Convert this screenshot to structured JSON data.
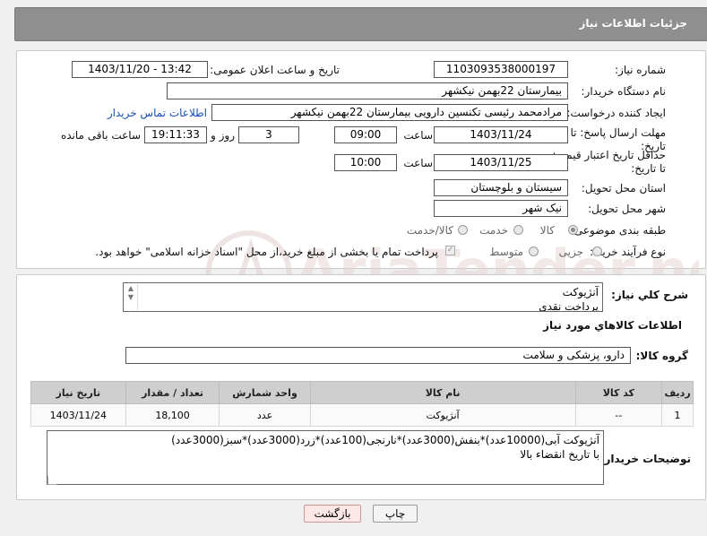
{
  "header": {
    "title": "جزئیات اطلاعات نیاز"
  },
  "form": {
    "need_number_label": "شماره نیاز:",
    "need_number": "1103093538000197",
    "announce_label": "تاریخ و ساعت اعلان عمومی:",
    "announce_value": "1403/11/20 - 13:42",
    "buyer_org_label": "نام دستگاه خریدار:",
    "buyer_org": "بیمارستان 22بهمن نیکشهر",
    "creator_label": "ایجاد کننده درخواست:",
    "creator": "مرادمحمد رئیسی تکنسین دارویی بیمارستان 22بهمن نیکشهر",
    "contact_link": "اطلاعات تماس خریدار",
    "reply_deadline_label": "مهلت ارسال پاسخ: تا تاریخ:",
    "reply_date": "1403/11/24",
    "time_label": "ساعت",
    "reply_time": "09:00",
    "days_value": "3",
    "days_label": "روز و",
    "remaining_time": "19:11:33",
    "remaining_label": "ساعت باقی مانده",
    "price_validity_label": "حداقل تاریخ اعتبار قیمت: تا تاریخ:",
    "price_date": "1403/11/25",
    "price_time": "10:00",
    "province_label": "استان محل تحویل:",
    "province": "سیستان و بلوچستان",
    "city_label": "شهر محل تحویل:",
    "city": "نیک شهر",
    "category_label": "طبقه بندی موضوعی:",
    "category_options": [
      "کالا",
      "خدمت",
      "کالا/خدمت"
    ],
    "process_label": "نوع فرآیند خرید :",
    "process_options": [
      "جزیی",
      "متوسط"
    ],
    "payment_note": "پرداخت تمام یا بخشی از مبلغ خرید،از محل \"اسناد خزانه اسلامی\" خواهد بود."
  },
  "summary": {
    "label": "شرح کلي نياز:",
    "text": "آنژیوکت\nپرداخت نقدی",
    "goods_info_title": "اطلاعات کالاهاي مورد نياز",
    "goods_group_label": "گروه کالا:",
    "goods_group": "دارو، پزشکی و سلامت"
  },
  "table": {
    "headers": [
      "رديف",
      "کد کالا",
      "نام کالا",
      "واحد شمارش",
      "تعداد / مقدار",
      "تاریخ نیاز"
    ],
    "rows": [
      [
        "1",
        "--",
        "آنژیوکت",
        "عدد",
        "18,100",
        "1403/11/24"
      ]
    ]
  },
  "buyer_notes": {
    "label": "توضیحات خریدار:",
    "text": "آنژیوکت آبی(10000عدد)*بنفش(3000عدد)*نارنجی(100عدد)*زرد(3000عدد)*سبز(3000عدد)\nبا تاریخ انقضاء بالا"
  },
  "buttons": {
    "print": "چاپ",
    "back": "بازگشت"
  },
  "watermark": {
    "text": "AriaTender.neT"
  }
}
